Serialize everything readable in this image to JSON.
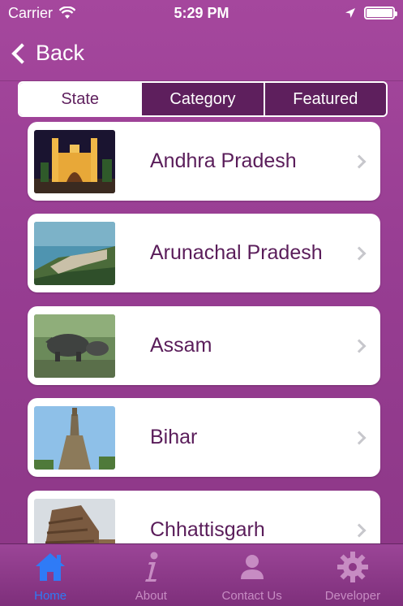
{
  "status_bar": {
    "carrier": "Carrier",
    "time": "5:29 PM"
  },
  "nav": {
    "back_label": "Back"
  },
  "segments": [
    {
      "label": "State",
      "active": true
    },
    {
      "label": "Category",
      "active": false
    },
    {
      "label": "Featured",
      "active": false
    }
  ],
  "list": {
    "items": [
      {
        "label": "Andhra Pradesh",
        "thumb": "charminar-night-photo"
      },
      {
        "label": "Arunachal Pradesh",
        "thumb": "hillside-lake-photo"
      },
      {
        "label": "Assam",
        "thumb": "rhinoceros-photo"
      },
      {
        "label": "Bihar",
        "thumb": "mahabodhi-temple-photo"
      },
      {
        "label": "Chhattisgarh",
        "thumb": "stone-temple-photo"
      }
    ]
  },
  "tab_bar": {
    "tabs": [
      {
        "label": "Home",
        "icon": "home-icon",
        "active": true
      },
      {
        "label": "About",
        "icon": "info-icon",
        "active": false
      },
      {
        "label": "Contact Us",
        "icon": "person-icon",
        "active": false
      },
      {
        "label": "Developer",
        "icon": "gear-icon",
        "active": false
      }
    ]
  },
  "colors": {
    "background": "#973d92",
    "accent": "#5e1f5d",
    "active_tab": "#2f7bf6"
  }
}
